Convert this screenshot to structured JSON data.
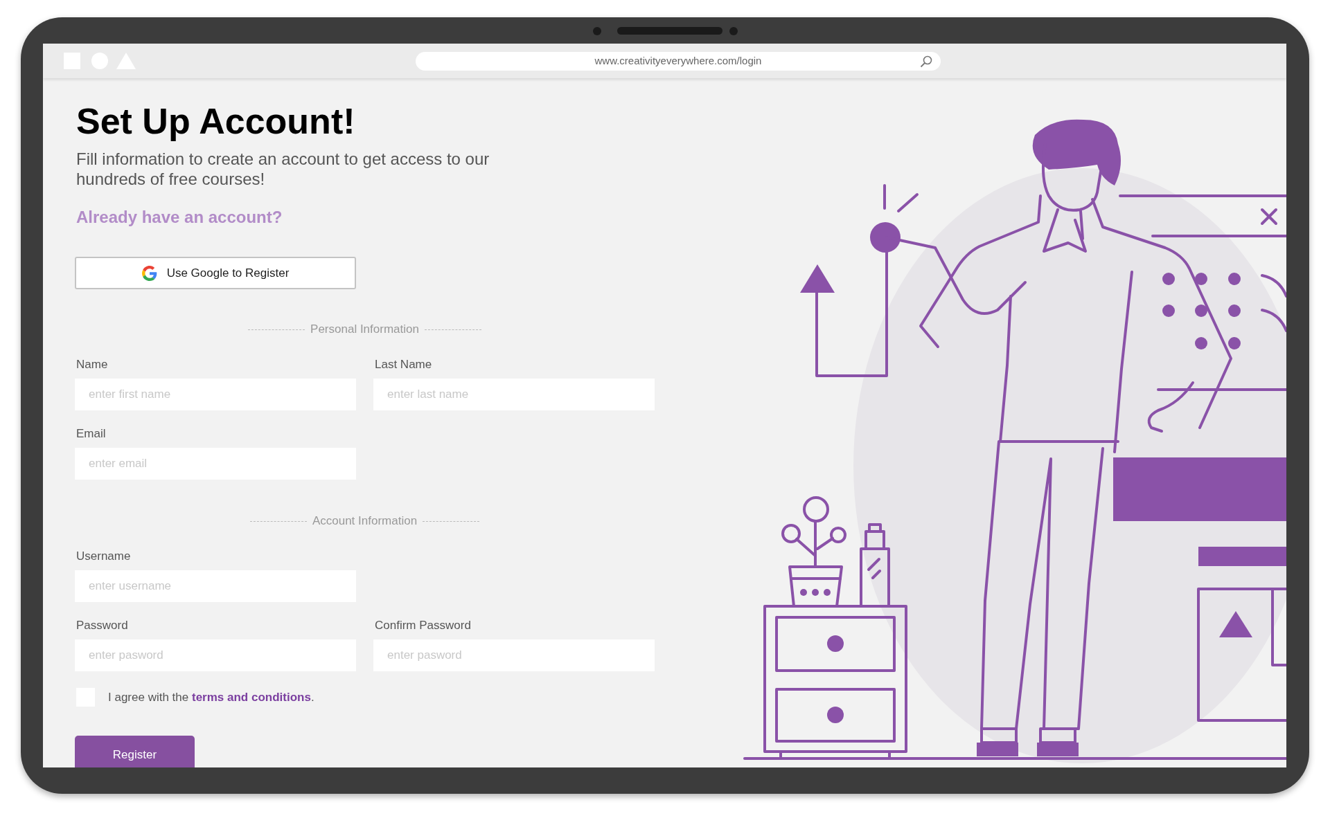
{
  "browser": {
    "url": "www.creativityeverywhere.com/login"
  },
  "heading": "Set Up Account!",
  "subtitle": "Fill information to create an account to get access to our hundreds of free courses!",
  "login_link": "Already have an account?",
  "google_button": "Use Google to Register",
  "sections": [
    {
      "title": "Personal Information",
      "rows": [
        [
          {
            "label": "Name",
            "placeholder": "enter first name"
          },
          {
            "label": "Last Name",
            "placeholder": "enter last name"
          }
        ],
        [
          {
            "label": "Email",
            "placeholder": "enter email"
          }
        ]
      ]
    },
    {
      "title": "Account Information",
      "rows": [
        [
          {
            "label": "Username",
            "placeholder": "enter username"
          }
        ],
        [
          {
            "label": "Password",
            "placeholder": "enter pasword"
          },
          {
            "label": "Confirm Password",
            "placeholder": "enter pasword"
          }
        ]
      ]
    }
  ],
  "agreement": {
    "checked": false,
    "text_before": "I agree with the ",
    "link": "terms and conditions",
    "text_after": "."
  },
  "submit_button": "Register"
}
